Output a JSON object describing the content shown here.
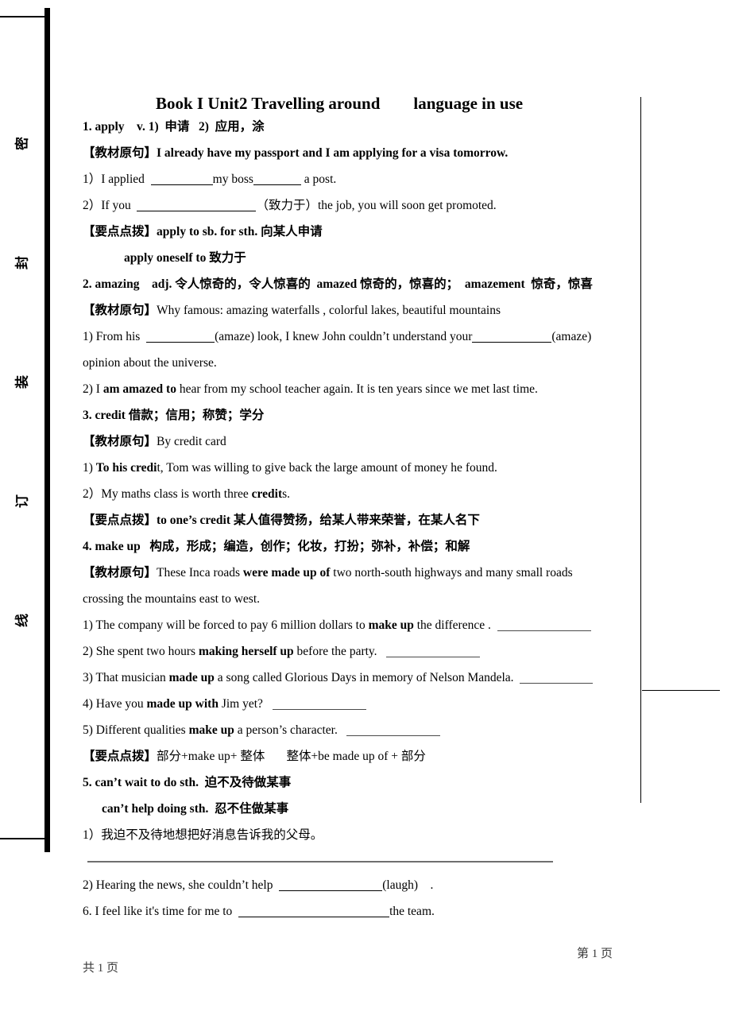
{
  "binding": {
    "labels": [
      "密",
      "封",
      "装",
      "订",
      "线"
    ]
  },
  "title": "Book I Unit2 Travelling around        language in use",
  "entries": [
    {
      "headword": "1. apply    v. 1)  申请   2)  应用，涂",
      "textbook_label": "【教材原句】",
      "textbook_sentence": "I already have my passport and I am applying for a visa tomorrow.",
      "exercise_1_pre": "1）I applied  ",
      "exercise_1_mid": "my boss",
      "exercise_1_post": " a post.",
      "exercise_2_pre": "2）If you  ",
      "exercise_2_post": "（致力于）the job, you will soon get promoted.",
      "tip_label": "【要点点拨】",
      "tip_1": "apply to sb. for sth.",
      "tip_1_cn": " 向某人申请",
      "tip_2": "apply oneself to",
      "tip_2_cn": " 致力于"
    },
    {
      "headword": "2. amazing    adj. 令人惊奇的，令人惊喜的  amazed 惊奇的，惊喜的；  amazement  惊奇，惊喜",
      "textbook_label": "【教材原句】",
      "textbook_sentence": "Why famous: amazing waterfalls , colorful lakes, beautiful mountains",
      "ex1_a": "1) From his  ",
      "ex1_b": "(amaze) look, I knew John couldn’t understand your",
      "ex1_c": "(amaze)",
      "ex1_cont": "opinion about the universe.",
      "ex2_pre": "2) I ",
      "ex2_bold": "am amazed to",
      "ex2_post": " hear from my school teacher again. It is ten years since we met last time."
    },
    {
      "headword_bold": "3. credit",
      "headword_cn": " 借款；信用；称赞；学分",
      "textbook_label": "【教材原句】",
      "textbook_sentence": "By credit card",
      "ex1_pre": "1) ",
      "ex1_bold": "To his credi",
      "ex1_post": "t, Tom was willing to give back the large amount of money he found.",
      "ex2_pre": "2）My maths class is worth three ",
      "ex2_bold": "credit",
      "ex2_post": "s.",
      "tip_label": "【要点点拨】",
      "tip_bold": "to one’s credit",
      "tip_cn": " 某人值得赞扬，给某人带来荣誉，在某人名下"
    },
    {
      "headword": "4. make up   构成，形成；编造，创作；化妆，打扮；弥补，补偿；和解",
      "textbook_label": "【教材原句】",
      "tb_pre": "These Inca roads ",
      "tb_bold": "were made up of",
      "tb_post": " two north-south highways and many small roads",
      "tb_cont": "crossing the mountains east to west.",
      "items": [
        {
          "pre": "1) The company will be forced to pay 6 million dollars to ",
          "bold": "make up",
          "post": " the difference ."
        },
        {
          "pre": "2) She spent two hours ",
          "bold": "making herself up",
          "post": " before the party."
        },
        {
          "pre": "3) That musician ",
          "bold": "made up",
          "post": " a song called Glorious Days in memory of Nelson Mandela."
        },
        {
          "pre": "4) Have you ",
          "bold": "made up with",
          "post": " Jim yet?"
        },
        {
          "pre": "5) Different qualities ",
          "bold": "make up",
          "post": " a person’s character."
        }
      ],
      "tip_label": "【要点点拨】",
      "tip_text": "部分+make up+ 整体       整体+be made up of + 部分"
    },
    {
      "head_1": "5. can’t wait to do sth.  迫不及待做某事",
      "head_2": "can’t help doing sth.  忍不住做某事",
      "ex1": "1）我迫不及待地想把好消息告诉我的父母。",
      "ex2_pre": "2) Hearing the news, she couldn’t help  ",
      "ex2_post": "(laugh)",
      "ex2_tail": ".",
      "ex3_pre": "6. I feel like it's time for me to  ",
      "ex3_post": "the team."
    }
  ],
  "footer": {
    "page_right": "第 1 页",
    "page_left": "共 1 页"
  }
}
